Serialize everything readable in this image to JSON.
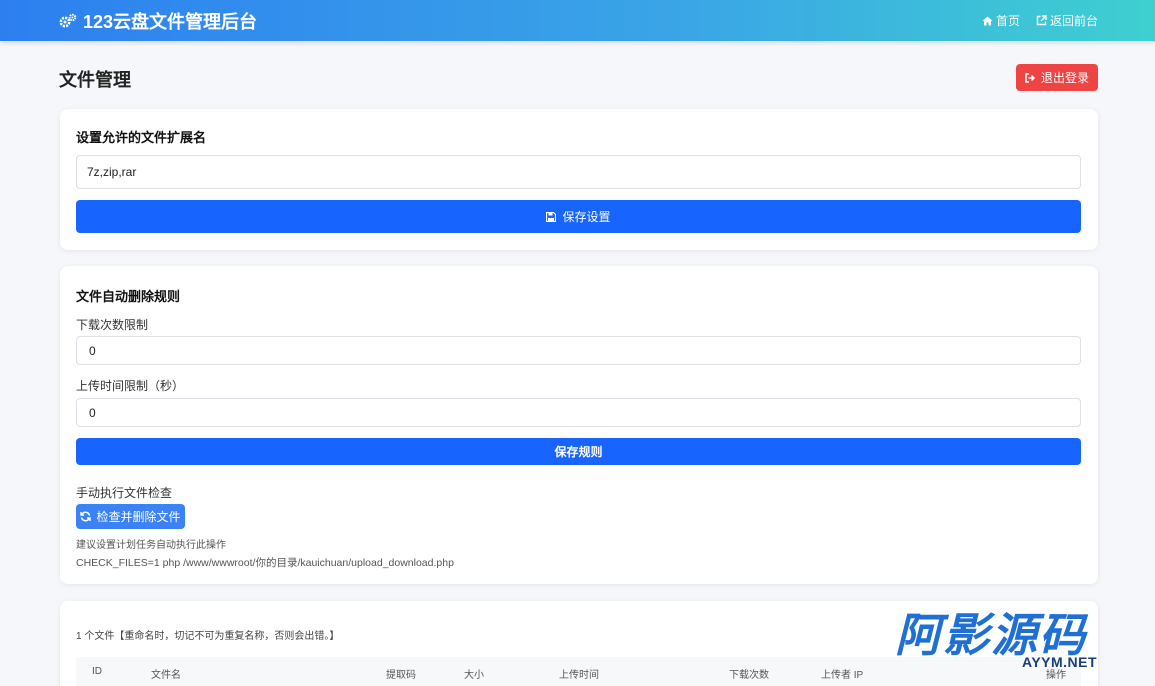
{
  "navbar": {
    "brand": "123云盘文件管理后台",
    "home": "首页",
    "back": "返回前台"
  },
  "page": {
    "title": "文件管理",
    "logout": "退出登录"
  },
  "extensions": {
    "title": "设置允许的文件扩展名",
    "value": "7z,zip,rar",
    "save": "保存设置"
  },
  "rules": {
    "title": "文件自动删除规则",
    "download_label": "下载次数限制",
    "download_value": "0",
    "time_label": "上传时间限制（秒）",
    "time_value": "0",
    "save": "保存规则",
    "manual_label": "手动执行文件检查",
    "check_button": "检查并删除文件",
    "hint": "建议设置计划任务自动执行此操作",
    "command": "CHECK_FILES=1 php /www/wwwroot/你的目录/kauichuan/upload_download.php"
  },
  "files": {
    "summary": "1 个文件【重命名时，切记不可为重复名称，否则会出错。】",
    "columns": [
      "ID",
      "文件名",
      "提取码",
      "大小",
      "上传时间",
      "下载次数",
      "上传者 IP",
      "操作"
    ]
  },
  "watermark": {
    "cn": "阿影源码",
    "en": "AYYM.NET"
  },
  "colors": {
    "primary": "#1764ff",
    "danger": "#ef4444",
    "info": "#3b82f6"
  }
}
